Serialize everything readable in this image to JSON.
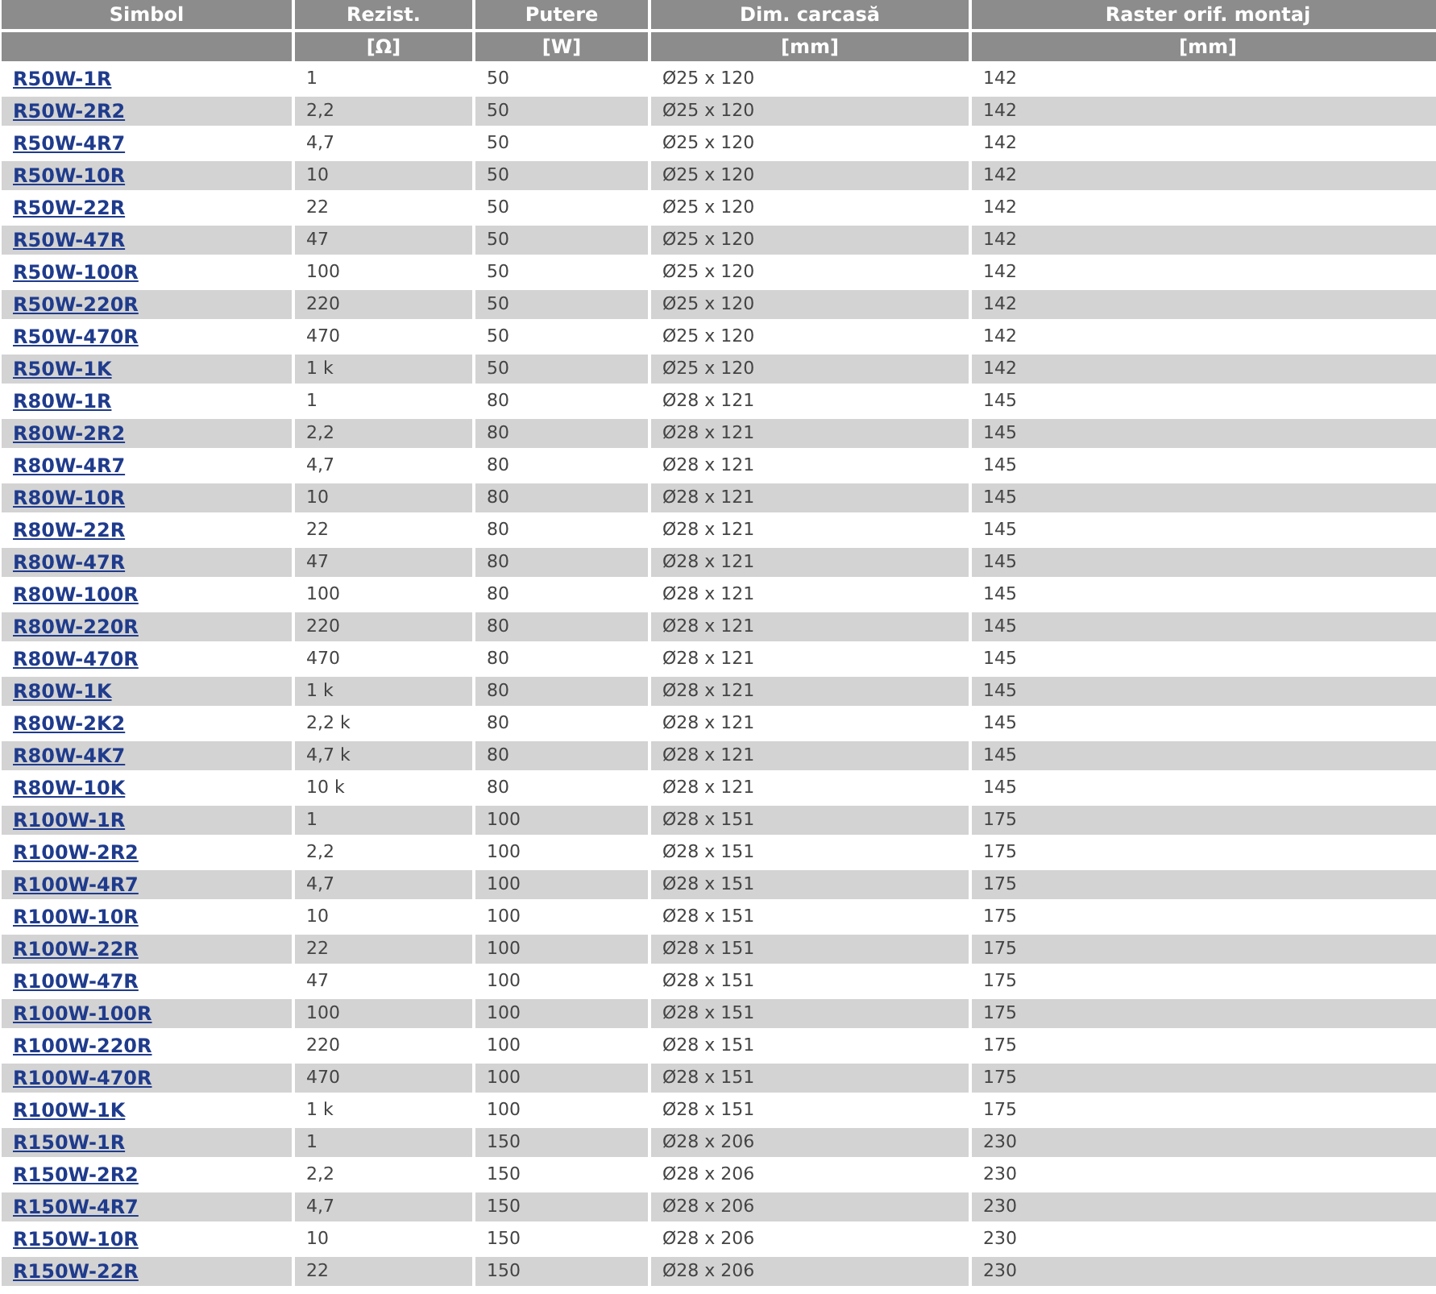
{
  "table": {
    "columns": [
      {
        "title": "Simbol"
      },
      {
        "title": "Rezist.",
        "unit": "[Ω]"
      },
      {
        "title": "Putere",
        "unit": "[W]"
      },
      {
        "title": "Dim. carcasă",
        "unit": "[mm]"
      },
      {
        "title": "Raster orif. montaj",
        "unit": "[mm]"
      }
    ],
    "rows": [
      [
        "R50W-1R",
        "1",
        "50",
        "Ø25 x 120",
        "142"
      ],
      [
        "R50W-2R2",
        "2,2",
        "50",
        "Ø25 x 120",
        "142"
      ],
      [
        "R50W-4R7",
        "4,7",
        "50",
        "Ø25 x 120",
        "142"
      ],
      [
        "R50W-10R",
        "10",
        "50",
        "Ø25 x 120",
        "142"
      ],
      [
        "R50W-22R",
        "22",
        "50",
        "Ø25 x 120",
        "142"
      ],
      [
        "R50W-47R",
        "47",
        "50",
        "Ø25 x 120",
        "142"
      ],
      [
        "R50W-100R",
        "100",
        "50",
        "Ø25 x 120",
        "142"
      ],
      [
        "R50W-220R",
        "220",
        "50",
        "Ø25 x 120",
        "142"
      ],
      [
        "R50W-470R",
        "470",
        "50",
        "Ø25 x 120",
        "142"
      ],
      [
        "R50W-1K",
        "1 k",
        "50",
        "Ø25 x 120",
        "142"
      ],
      [
        "R80W-1R",
        "1",
        "80",
        "Ø28 x 121",
        "145"
      ],
      [
        "R80W-2R2",
        "2,2",
        "80",
        "Ø28 x 121",
        "145"
      ],
      [
        "R80W-4R7",
        "4,7",
        "80",
        "Ø28 x 121",
        "145"
      ],
      [
        "R80W-10R",
        "10",
        "80",
        "Ø28 x 121",
        "145"
      ],
      [
        "R80W-22R",
        "22",
        "80",
        "Ø28 x 121",
        "145"
      ],
      [
        "R80W-47R",
        "47",
        "80",
        "Ø28 x 121",
        "145"
      ],
      [
        "R80W-100R",
        "100",
        "80",
        "Ø28 x 121",
        "145"
      ],
      [
        "R80W-220R",
        "220",
        "80",
        "Ø28 x 121",
        "145"
      ],
      [
        "R80W-470R",
        "470",
        "80",
        "Ø28 x 121",
        "145"
      ],
      [
        "R80W-1K",
        "1 k",
        "80",
        "Ø28 x 121",
        "145"
      ],
      [
        "R80W-2K2",
        "2,2 k",
        "80",
        "Ø28 x 121",
        "145"
      ],
      [
        "R80W-4K7",
        "4,7 k",
        "80",
        "Ø28 x 121",
        "145"
      ],
      [
        "R80W-10K",
        "10 k",
        "80",
        "Ø28 x 121",
        "145"
      ],
      [
        "R100W-1R",
        "1",
        "100",
        "Ø28 x 151",
        "175"
      ],
      [
        "R100W-2R2",
        "2,2",
        "100",
        "Ø28 x 151",
        "175"
      ],
      [
        "R100W-4R7",
        "4,7",
        "100",
        "Ø28 x 151",
        "175"
      ],
      [
        "R100W-10R",
        "10",
        "100",
        "Ø28 x 151",
        "175"
      ],
      [
        "R100W-22R",
        "22",
        "100",
        "Ø28 x 151",
        "175"
      ],
      [
        "R100W-47R",
        "47",
        "100",
        "Ø28 x 151",
        "175"
      ],
      [
        "R100W-100R",
        "100",
        "100",
        "Ø28 x 151",
        "175"
      ],
      [
        "R100W-220R",
        "220",
        "100",
        "Ø28 x 151",
        "175"
      ],
      [
        "R100W-470R",
        "470",
        "100",
        "Ø28 x 151",
        "175"
      ],
      [
        "R100W-1K",
        "1 k",
        "100",
        "Ø28 x 151",
        "175"
      ],
      [
        "R150W-1R",
        "1",
        "150",
        "Ø28 x 206",
        "230"
      ],
      [
        "R150W-2R2",
        "2,2",
        "150",
        "Ø28 x 206",
        "230"
      ],
      [
        "R150W-4R7",
        "4,7",
        "150",
        "Ø28 x 206",
        "230"
      ],
      [
        "R150W-10R",
        "10",
        "150",
        "Ø28 x 206",
        "230"
      ],
      [
        "R150W-22R",
        "22",
        "150",
        "Ø28 x 206",
        "230"
      ]
    ]
  }
}
